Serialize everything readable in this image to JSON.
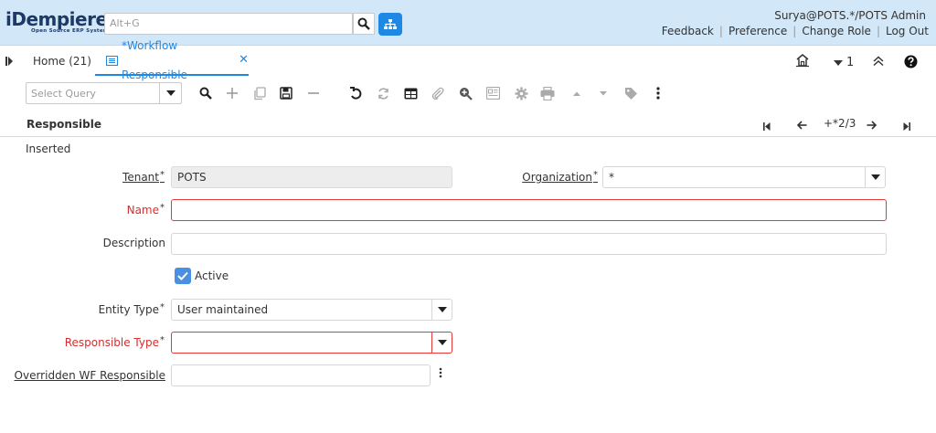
{
  "header": {
    "logo_main": "iDempiere",
    "logo_sub": "Open Source ERP System",
    "search_placeholder": "Alt+G",
    "user": "Surya@POTS.*/POTS Admin",
    "links": [
      "Feedback",
      "Preference",
      "Change Role",
      "Log Out"
    ]
  },
  "tabs": {
    "home": "Home (21)",
    "active": "*Workflow Responsible",
    "close": "✕",
    "counter": "1"
  },
  "toolbar": {
    "query_placeholder": "Select Query"
  },
  "section": {
    "title": "Responsible",
    "record_position": "+*2/3"
  },
  "status": "Inserted",
  "form": {
    "tenant_label": "Tenant",
    "tenant_value": "POTS",
    "org_label": "Organization",
    "org_value": "*",
    "name_label": "Name",
    "name_value": "",
    "description_label": "Description",
    "description_value": "",
    "active_label": "Active",
    "entity_type_label": "Entity Type",
    "entity_type_value": "User maintained",
    "responsible_type_label": "Responsible Type",
    "responsible_type_value": "",
    "overridden_label": "Overridden WF Responsible",
    "overridden_value": "",
    "required_mark": "*"
  },
  "colors": {
    "header_bg": "#d2e7f7",
    "accent": "#1e88e5",
    "error": "#e53935"
  }
}
